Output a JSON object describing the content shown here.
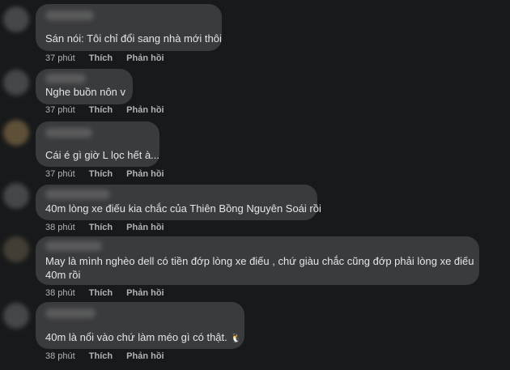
{
  "comments": [
    {
      "text": "Sán nói: Tôi chỉ đổi sang nhà mới thôi",
      "time": "37 phút",
      "like": "Thích",
      "reply": "Phản hồi"
    },
    {
      "text": "Nghe buồn nôn v",
      "time": "37 phút",
      "like": "Thích",
      "reply": "Phản hồi"
    },
    {
      "text": "Cái é gì giờ L lọc hết à...",
      "time": "37 phút",
      "like": "Thích",
      "reply": "Phản hồi"
    },
    {
      "text": "40m lòng xe điếu kia chắc của Thiên Bồng Nguyên Soái rồi",
      "time": "38 phút",
      "like": "Thích",
      "reply": "Phản hồi"
    },
    {
      "text": "May là mình nghèo dell có tiền đớp lòng xe điếu , chứ giàu chắc cũng đớp phải lòng xe điếu 40m rồi",
      "time": "38 phút",
      "like": "Thích",
      "reply": "Phản hồi"
    },
    {
      "text": "40m là nổi vào chứ làm méo gì có thật.",
      "emoji": "🐧",
      "time": "38 phút",
      "like": "Thích",
      "reply": "Phản hồi"
    }
  ],
  "colors": {
    "background": "#18191a",
    "bubble": "#3a3b3c",
    "text": "#e4e6eb",
    "muted": "#b0b3b8"
  },
  "icons": {
    "emoji": "penguin-emoji-icon"
  }
}
